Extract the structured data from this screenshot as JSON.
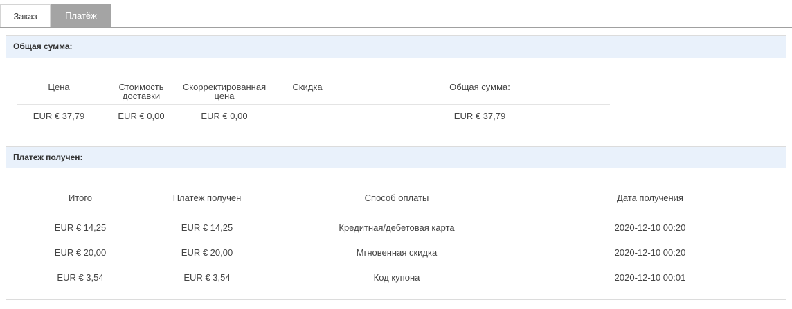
{
  "tabs": [
    {
      "label": "Заказ",
      "active": false
    },
    {
      "label": "Платёж",
      "active": true
    }
  ],
  "summary": {
    "title": "Общая сумма:",
    "headers": {
      "price": "Цена",
      "shipping": "Стоимость доставки",
      "adjusted": "Скорректированная цена",
      "discount": "Скидка",
      "total": "Общая сумма:"
    },
    "values": {
      "price": "EUR € 37,79",
      "shipping": "EUR € 0,00",
      "adjusted": "EUR € 0,00",
      "discount": "",
      "total": "EUR € 37,79"
    }
  },
  "payments": {
    "title": "Платеж получен:",
    "headers": {
      "subtotal": "Итого",
      "received": "Платёж получен",
      "method": "Способ оплаты",
      "date": "Дата получения"
    },
    "rows": [
      {
        "subtotal": "EUR € 14,25",
        "received": "EUR € 14,25",
        "method": "Кредитная/дебетовая карта",
        "date": "2020-12-10 00:20"
      },
      {
        "subtotal": "EUR € 20,00",
        "received": "EUR € 20,00",
        "method": "Мгновенная скидка",
        "date": "2020-12-10 00:20"
      },
      {
        "subtotal": "EUR € 3,54",
        "received": "EUR € 3,54",
        "method": "Код купона",
        "date": "2020-12-10 00:01"
      }
    ]
  },
  "colors": {
    "panel_header_bg": "#e9f1fb",
    "active_tab_bg": "#a4a4a4",
    "tab_underline": "#a0a0a0"
  }
}
